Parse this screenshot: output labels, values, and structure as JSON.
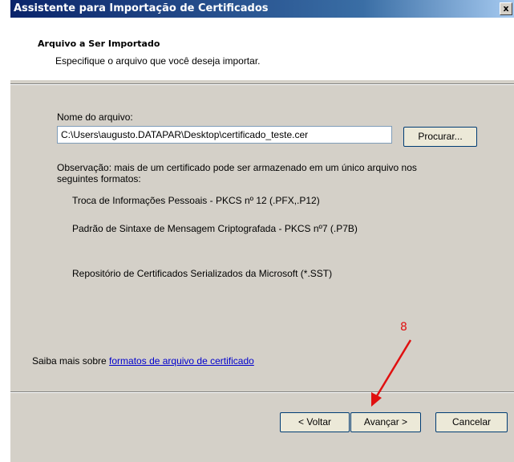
{
  "window": {
    "title": "Assistente para Importação de Certificados",
    "close_label": "x"
  },
  "header": {
    "title": "Arquivo a Ser Importado",
    "subtitle": "Especifique o arquivo que você deseja importar."
  },
  "form": {
    "filename_label": "Nome do arquivo:",
    "filename_value": "C:\\Users\\augusto.DATAPAR\\Desktop\\certificado_teste.cer",
    "browse_label": "Procurar...",
    "note_line1": "Observação: mais de um certificado pode ser armazenado em um único arquivo nos",
    "note_line2": "seguintes formatos:",
    "formats": [
      "Troca de Informações Pessoais - PKCS nº 12 (.PFX,.P12)",
      "Padrão de Sintaxe de Mensagem Criptografada - PKCS nº7 (.P7B)",
      "Repositório de Certificados Serializados da Microsoft (*.SST)"
    ]
  },
  "learn_more": {
    "prefix": "Saiba mais sobre ",
    "link": "formatos de arquivo de certificado"
  },
  "footer": {
    "back_label": "< Voltar",
    "next_label": "Avançar >",
    "cancel_label": "Cancelar"
  },
  "annotation": {
    "number": "8",
    "color": "#e01010"
  }
}
